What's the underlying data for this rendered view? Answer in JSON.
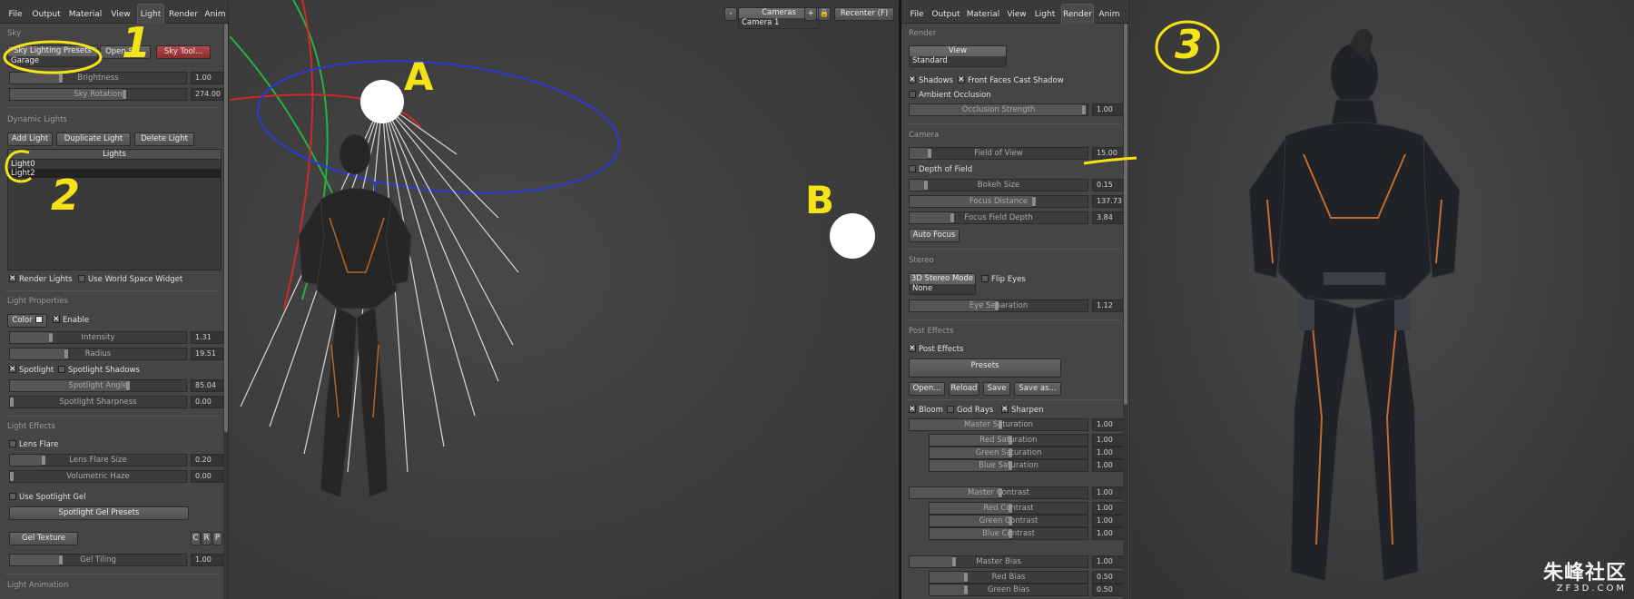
{
  "left_panel": {
    "tabs": [
      "File",
      "Output",
      "Material",
      "View",
      "Light",
      "Render",
      "Anim"
    ],
    "active_tab": "Light",
    "sky": {
      "section": "Sky",
      "presets_label": "Sky Lighting Presets",
      "presets_value": "Garage",
      "open_sky_label": "Open Sk...",
      "sky_tool_label": "Sky Tool...",
      "brightness": {
        "label": "Brightness",
        "value": "1.00"
      },
      "rotation": {
        "label": "Sky Rotation",
        "value": "274.00"
      }
    },
    "dynamic_lights": {
      "section": "Dynamic Lights",
      "add_label": "Add Light",
      "duplicate_label": "Duplicate Light",
      "delete_label": "Delete Light",
      "list_header": "Lights",
      "items": [
        "Light0",
        "Light2"
      ],
      "render_lights_label": "Render Lights",
      "world_widget_label": "Use World Space Widget"
    },
    "light_properties": {
      "section": "Light Properties",
      "color_label": "Color",
      "enable_label": "Enable",
      "intensity": {
        "label": "Intensity",
        "value": "1.31"
      },
      "radius": {
        "label": "Radius",
        "value": "19.51"
      },
      "spotlight_label": "Spotlight",
      "spot_shadows_label": "Spotlight Shadows",
      "spot_angle": {
        "label": "Spotlight Angle",
        "value": "85.04"
      },
      "spot_sharpness": {
        "label": "Spotlight Sharpness",
        "value": "0.00"
      }
    },
    "light_effects": {
      "section": "Light Effects",
      "lens_flare_label": "Lens Flare",
      "flare_size": {
        "label": "Lens Flare Size",
        "value": "0.20"
      },
      "haze": {
        "label": "Volumetric Haze",
        "value": "0.00"
      },
      "gel_label": "Use Spotlight Gel",
      "gel_presets_label": "Spotlight Gel Presets",
      "gel_texture_label": "Gel Texture",
      "gel_letters": [
        "C",
        "R",
        "P"
      ],
      "gel_tiling": {
        "label": "Gel Tiling",
        "value": "1.00"
      }
    },
    "light_animation": {
      "section": "Light Animation"
    }
  },
  "viewport": {
    "minus_label": "-",
    "cameras_label": "Cameras",
    "camera_value": "Camera 1",
    "plus_label": "+",
    "recenter_label": "Recenter (F)"
  },
  "right_panel": {
    "tabs": [
      "File",
      "Output",
      "Material",
      "View",
      "Light",
      "Render",
      "Anim"
    ],
    "active_tab": "Render",
    "render": {
      "section": "Render",
      "view_label": "View",
      "view_value": "Standard",
      "shadows_label": "Shadows",
      "front_faces_label": "Front Faces Cast Shadow",
      "ao_label": "Ambient Occlusion",
      "occlusion": {
        "label": "Occlusion Strength",
        "value": "1.00"
      }
    },
    "camera": {
      "section": "Camera",
      "fov": {
        "label": "Field of View",
        "value": "15.00"
      },
      "dof_label": "Depth of Field",
      "bokeh": {
        "label": "Bokeh Size",
        "value": "0.15"
      },
      "focus_distance": {
        "label": "Focus Distance",
        "value": "137.73"
      },
      "focus_depth": {
        "label": "Focus Field Depth",
        "value": "3.84"
      },
      "auto_focus_label": "Auto Focus"
    },
    "stereo": {
      "section": "Stereo",
      "mode_label": "3D Stereo Mode",
      "mode_value": "None",
      "flip_eyes_label": "Flip Eyes",
      "eye_sep": {
        "label": "Eye Separation",
        "value": "1.12"
      }
    },
    "post_effects": {
      "section": "Post Effects",
      "enable_label": "Post Effects",
      "presets_label": "Presets",
      "open_label": "Open...",
      "reload_label": "Reload",
      "save_label": "Save",
      "save_as_label": "Save as...",
      "bloom_label": "Bloom",
      "god_rays_label": "God Rays",
      "sharpen_label": "Sharpen",
      "master_saturation": {
        "label": "Master Saturation",
        "value": "1.00"
      },
      "red_saturation": {
        "label": "Red Saturation",
        "value": "1.00"
      },
      "green_saturation": {
        "label": "Green Saturation",
        "value": "1.00"
      },
      "blue_saturation": {
        "label": "Blue Saturation",
        "value": "1.00"
      },
      "master_contrast": {
        "label": "Master Contrast",
        "value": "1.00"
      },
      "red_contrast": {
        "label": "Red Contrast",
        "value": "1.00"
      },
      "green_contrast": {
        "label": "Green Contrast",
        "value": "1.00"
      },
      "blue_contrast": {
        "label": "Blue Contrast",
        "value": "1.00"
      },
      "master_bias": {
        "label": "Master Bias",
        "value": "1.00"
      },
      "red_bias": {
        "label": "Red Bias",
        "value": "0.50"
      },
      "green_bias": {
        "label": "Green Bias",
        "value": "0.50"
      }
    }
  },
  "annotations": {
    "one": "1",
    "two": "2",
    "three": "3",
    "a": "A",
    "b": "B"
  },
  "watermark": {
    "chinese": "朱峰社区",
    "domain": "ZF3D.COM"
  },
  "colors": {
    "annotation_yellow": "#f4e417",
    "sky_tool_red": "#9e3a3c",
    "gizmo_red": "#d02828",
    "gizmo_green": "#28b040",
    "gizmo_blue": "#2a3ad0"
  }
}
